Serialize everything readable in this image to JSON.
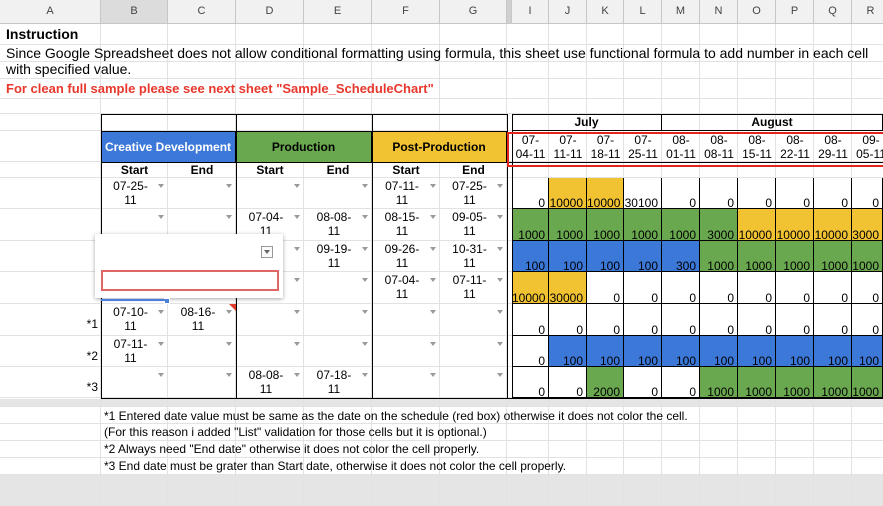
{
  "columns": [
    "A",
    "B",
    "C",
    "D",
    "E",
    "F",
    "G",
    "I",
    "J",
    "K",
    "L",
    "M",
    "N",
    "O",
    "P",
    "Q",
    "R"
  ],
  "selected_column": "B",
  "colors": {
    "blue": "#3c78d8",
    "green": "#6aa84f",
    "yellow": "#f1c232",
    "red": "#e06666",
    "red_text": "#e8372c",
    "stripe": "#e5e5e5",
    "header_bg": "#f1f1f1"
  },
  "instruction": {
    "title": "Instruction",
    "line1": "Since Google Spreadsheet does not allow conditional formatting using formula, this sheet use functional formula to add number in each cell",
    "line2": "with specified value.",
    "red_note": "For clean full sample please see next sheet \"Sample_ScheduleChart\""
  },
  "phases": [
    {
      "label": "Creative Development",
      "color": "blue"
    },
    {
      "label": "Production",
      "color": "green"
    },
    {
      "label": "Post-Production",
      "color": "yellow"
    }
  ],
  "subheaders": {
    "start": "Start",
    "end": "End"
  },
  "months": [
    "July",
    "August"
  ],
  "dates": [
    [
      "07-",
      "04-11"
    ],
    [
      "07-",
      "11-11"
    ],
    [
      "07-",
      "18-11"
    ],
    [
      "07-",
      "25-11"
    ],
    [
      "08-",
      "01-11"
    ],
    [
      "08-",
      "08-11"
    ],
    [
      "08-",
      "15-11"
    ],
    [
      "08-",
      "22-11"
    ],
    [
      "08-",
      "29-11"
    ],
    [
      "09-",
      "05-11"
    ]
  ],
  "rows": [
    {
      "label": "",
      "entries": [
        [
          "07-25-",
          "11"
        ],
        null,
        null,
        null,
        [
          "07-11-",
          "11"
        ],
        [
          "07-25-",
          "11"
        ]
      ],
      "values": [
        "0",
        "10000",
        "10000",
        "30100",
        "0",
        "0",
        "0",
        "0",
        "0",
        "0"
      ],
      "fills": [
        "",
        "yellow",
        "yellow",
        "",
        "",
        "",
        "",
        "",
        "",
        ""
      ]
    },
    {
      "label": "",
      "entries": [
        null,
        null,
        [
          "07-04-",
          "11"
        ],
        [
          "08-08-",
          "11"
        ],
        [
          "08-15-",
          "11"
        ],
        [
          "09-05-",
          "11"
        ]
      ],
      "values": [
        "1000",
        "1000",
        "1000",
        "1000",
        "1000",
        "3000",
        "10000",
        "10000",
        "10000",
        "3000"
      ],
      "fills": [
        "green",
        "green",
        "green",
        "green",
        "green",
        "green",
        "yellow",
        "yellow",
        "yellow",
        "yellow"
      ]
    },
    {
      "label": "",
      "entries": [
        null,
        null,
        null,
        [
          "09-19-",
          "11"
        ],
        [
          "09-26-",
          "11"
        ],
        [
          "10-31-",
          "11"
        ]
      ],
      "values": [
        "100",
        "100",
        "100",
        "100",
        "300",
        "1000",
        "1000",
        "1000",
        "1000",
        "1000"
      ],
      "fills": [
        "blue",
        "blue",
        "blue",
        "blue",
        "blue",
        "green",
        "green",
        "green",
        "green",
        "green"
      ]
    },
    {
      "label": "",
      "entries": [
        null,
        null,
        null,
        null,
        [
          "07-04-",
          "11"
        ],
        [
          "07-11-",
          "11"
        ]
      ],
      "values": [
        "10000",
        "30000",
        "0",
        "0",
        "0",
        "0",
        "0",
        "0",
        "0",
        "0"
      ],
      "fills": [
        "yellow",
        "yellow",
        "",
        "",
        "",
        "",
        "",
        "",
        "",
        ""
      ]
    },
    {
      "label": "*1",
      "entries": [
        [
          "07-10-",
          "11"
        ],
        [
          "08-16-",
          "11"
        ],
        null,
        null,
        null,
        null
      ],
      "values": [
        "0",
        "0",
        "0",
        "0",
        "0",
        "0",
        "0",
        "0",
        "0",
        "0"
      ],
      "fills": [
        "",
        "",
        "",
        "",
        "",
        "",
        "",
        "",
        "",
        ""
      ]
    },
    {
      "label": "*2",
      "entries": [
        [
          "07-11-",
          "11"
        ],
        null,
        null,
        null,
        null,
        null
      ],
      "values": [
        "0",
        "100",
        "100",
        "100",
        "100",
        "100",
        "100",
        "100",
        "100",
        "100"
      ],
      "fills": [
        "",
        "blue",
        "blue",
        "blue",
        "blue",
        "blue",
        "blue",
        "blue",
        "blue",
        "blue"
      ]
    },
    {
      "label": "*3",
      "entries": [
        null,
        null,
        [
          "08-08-",
          "11"
        ],
        [
          "07-18-",
          "11"
        ],
        null,
        null
      ],
      "values": [
        "0",
        "0",
        "2000",
        "0",
        "0",
        "1000",
        "1000",
        "1000",
        "1000",
        "1000"
      ],
      "fills": [
        "",
        "",
        "green",
        "",
        "",
        "green",
        "green",
        "green",
        "green",
        "green"
      ]
    }
  ],
  "notes": [
    "*1 Entered date value must be same as the date on the schedule (red box) otherwise it does not color the cell.",
    "(For this reason i added \"List\" validation for those cells but it is optional.)",
    "*2 Always need \"End date\" otherwise it does not color the cell properly.",
    "*3 End date must be grater than Start date, otherwise it does not color the cell properly."
  ]
}
